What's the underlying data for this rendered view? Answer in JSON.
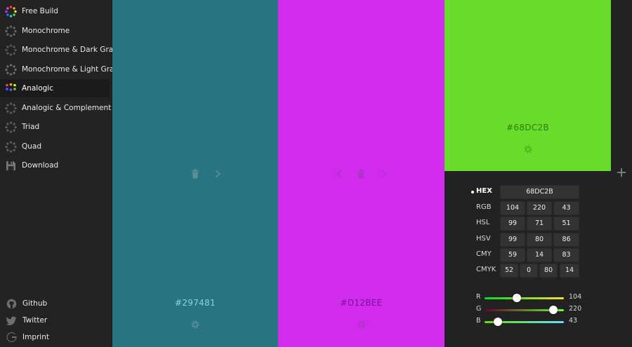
{
  "sidebar": {
    "items": [
      {
        "label": "Free Build",
        "icon": "free-build-icon",
        "active": false
      },
      {
        "label": "Monochrome",
        "icon": "monochrome-icon",
        "active": false
      },
      {
        "label": "Monochrome & Dark Gray",
        "icon": "monochrome-dark-gray-icon",
        "active": false
      },
      {
        "label": "Monochrome & Light Gray",
        "icon": "monochrome-light-gray-icon",
        "active": false
      },
      {
        "label": "Analogic",
        "icon": "analogic-icon",
        "active": true
      },
      {
        "label": "Analogic & Complement",
        "icon": "analogic-complement-icon",
        "active": false
      },
      {
        "label": "Triad",
        "icon": "triad-icon",
        "active": false
      },
      {
        "label": "Quad",
        "icon": "quad-icon",
        "active": false
      },
      {
        "label": "Download",
        "icon": "download-icon",
        "active": false
      }
    ],
    "footer": [
      {
        "label": "Github",
        "icon": "github-icon"
      },
      {
        "label": "Twitter",
        "icon": "twitter-icon"
      },
      {
        "label": "Imprint",
        "icon": "imprint-icon"
      }
    ]
  },
  "swatches": [
    {
      "hex_label": "#297481",
      "color": "#297481",
      "label_color": "#7fd8e8"
    },
    {
      "hex_label": "#D12BEE",
      "color": "#D12BEE",
      "label_color": "#7a1296"
    },
    {
      "hex_label": "#68DC2B",
      "color": "#68DC2B",
      "label_color": "#2f7d0c"
    }
  ],
  "panel": {
    "hex": {
      "label": "HEX",
      "value": "68DC2B"
    },
    "rows": [
      {
        "label": "RGB",
        "values": [
          "104",
          "220",
          "43"
        ]
      },
      {
        "label": "HSL",
        "values": [
          "99",
          "71",
          "51"
        ]
      },
      {
        "label": "HSV",
        "values": [
          "99",
          "80",
          "86"
        ]
      },
      {
        "label": "CMY",
        "values": [
          "59",
          "14",
          "83"
        ]
      }
    ],
    "cmyk": {
      "label": "CMYK",
      "values": [
        "52",
        "0",
        "80",
        "14"
      ]
    },
    "sliders": [
      {
        "label": "R",
        "value": "104",
        "fraction": 0.408
      },
      {
        "label": "G",
        "value": "220",
        "fraction": 0.863
      },
      {
        "label": "B",
        "value": "43",
        "fraction": 0.169
      }
    ]
  },
  "colors": {
    "sidebar_bg": "#232323",
    "panel_bg": "#222222",
    "value_box_bg": "#333333"
  }
}
